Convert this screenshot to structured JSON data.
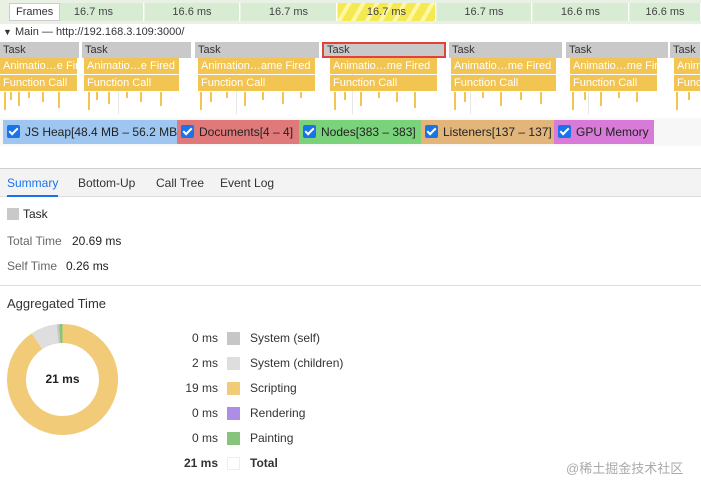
{
  "frames": {
    "label": "Frames",
    "cells": [
      "16.7 ms",
      "16.6 ms",
      "16.7 ms",
      "16.7 ms",
      "16.7 ms",
      "16.6 ms",
      "16.6 ms"
    ]
  },
  "main": {
    "label": "Main — http://192.168.3.109:3000/"
  },
  "flame": {
    "tasks": [
      "Task",
      "Task",
      "Task",
      "Task",
      "Task",
      "Task",
      "Task"
    ],
    "anims": [
      "Animatio…e Fired",
      "Animatio…e Fired",
      "Animation…ame Fired",
      "Animatio…me Fired",
      "Animatio…me Fired",
      "Animatio…me Fired",
      "Anim"
    ],
    "calls": [
      "Function Call",
      "Function Call",
      "Function Call",
      "Function Call",
      "Function Call",
      "Function Call",
      "Funct"
    ]
  },
  "counters": [
    {
      "label": "JS Heap[48.4 MB – 56.2 MB]",
      "color": "#9ec6f0"
    },
    {
      "label": "Documents[4 – 4]",
      "color": "#e07a7a"
    },
    {
      "label": "Nodes[383 – 383]",
      "color": "#7ad27a"
    },
    {
      "label": "Listeners[137 – 137]",
      "color": "#e2b57a"
    },
    {
      "label": "GPU Memory",
      "color": "#d87ad8"
    }
  ],
  "tabs": [
    "Summary",
    "Bottom-Up",
    "Call Tree",
    "Event Log"
  ],
  "summary": {
    "title": "Task",
    "total_label": "Total Time",
    "total_value": "20.69 ms",
    "self_label": "Self Time",
    "self_value": "0.26 ms"
  },
  "aggregated": {
    "title": "Aggregated Time",
    "center": "21 ms",
    "rows": [
      {
        "value": "0 ms",
        "label": "System (self)",
        "color": "#c6c6c6",
        "bold": false
      },
      {
        "value": "2 ms",
        "label": "System (children)",
        "color": "#dedede",
        "bold": false
      },
      {
        "value": "19 ms",
        "label": "Scripting",
        "color": "#f2cb79",
        "bold": false
      },
      {
        "value": "0 ms",
        "label": "Rendering",
        "color": "#ad8ee6",
        "bold": false
      },
      {
        "value": "0 ms",
        "label": "Painting",
        "color": "#86c47c",
        "bold": false
      },
      {
        "value": "21 ms",
        "label": "Total",
        "color": "#ffffff",
        "bold": true
      }
    ],
    "slices": [
      {
        "name": "Scripting",
        "value": 19,
        "color": "#f2cb79"
      },
      {
        "name": "System (children)",
        "value": 1.6,
        "color": "#dedede"
      },
      {
        "name": "System (self)",
        "value": 0.15,
        "color": "#c6c6c6"
      },
      {
        "name": "Painting",
        "value": 0.2,
        "color": "#86c47c"
      }
    ]
  },
  "watermark": "@稀土掘金技术社区"
}
